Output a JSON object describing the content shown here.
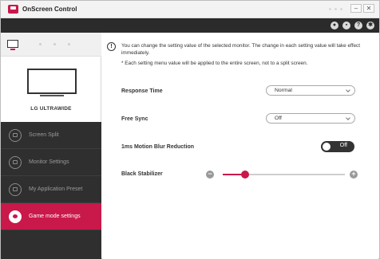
{
  "window": {
    "title": "OnScreen Control",
    "controls": {
      "minimize": "–",
      "maximize": "",
      "close": "✕"
    }
  },
  "topbar": {
    "icons": [
      "account-icon",
      "display-icon",
      "help-icon",
      "settings-icon"
    ]
  },
  "sidebar": {
    "monitor_brand": "LG ULTRAWIDE",
    "items": [
      {
        "label": "Screen Split",
        "icon": "screen-split-icon",
        "active": false
      },
      {
        "label": "Monitor Settings",
        "icon": "monitor-settings-icon",
        "active": false
      },
      {
        "label": "My Application Preset",
        "icon": "app-preset-icon",
        "active": false
      },
      {
        "label": "Game mode settings",
        "icon": "game-mode-icon",
        "active": true
      }
    ]
  },
  "content": {
    "info_text": "You can change the setting value of the selected monitor. The change in each setting value will take effect immediately.",
    "info_note": "* Each setting menu value will be applied to the entire screen, not to a split screen.",
    "settings": {
      "response_time": {
        "label": "Response Time",
        "value": "Normal"
      },
      "free_sync": {
        "label": "Free Sync",
        "value": "Off"
      },
      "motion_blur": {
        "label": "1ms Motion Blur Reduction",
        "value": "Off"
      },
      "black_stabilizer": {
        "label": "Black Stabilizer",
        "level_fraction": 0.18
      }
    }
  },
  "colors": {
    "accent": "#c9184a",
    "sidebar_bg": "#2f2f2f",
    "topbar_bg": "#2b2b2b"
  }
}
